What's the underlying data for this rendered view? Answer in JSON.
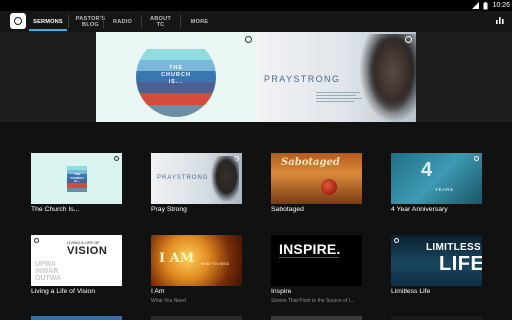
{
  "status_bar": {
    "time": "10:26"
  },
  "top_nav": {
    "tabs": [
      {
        "label": "SERMONS",
        "active": true
      },
      {
        "label": "PASTOR'S\nBLOG",
        "active": false
      },
      {
        "label": "RADIO",
        "active": false
      },
      {
        "label": "ABOUT\nTC",
        "active": false
      },
      {
        "label": "MORE",
        "active": false
      }
    ]
  },
  "hero": {
    "left": {
      "title_lines": [
        "THE",
        "CHURCH",
        "IS..."
      ]
    },
    "right": {
      "title": "PRAYSTRONG"
    }
  },
  "sermons": [
    {
      "title": "The Church Is...",
      "subtitle": ""
    },
    {
      "title": "Pray Strong",
      "subtitle": ""
    },
    {
      "title": "Sabotaged",
      "subtitle": ""
    },
    {
      "title": "4 Year Anniversary",
      "subtitle": ""
    },
    {
      "title": "Living a Life of Vision",
      "subtitle": ""
    },
    {
      "title": "I Am",
      "subtitle": "What You Need"
    },
    {
      "title": "Inspire",
      "subtitle": "Stories That Point to the Source of I..."
    },
    {
      "title": "Limitless Life",
      "subtitle": ""
    }
  ],
  "thumbs": {
    "church": [
      "THE",
      "CHURCH",
      "IS..."
    ],
    "praystrong": "PRAYSTRONG",
    "sabotaged": "Sabotaged",
    "anniversary": {
      "number": "4",
      "label": "YEARS"
    },
    "vision": {
      "small": "LIVING A LIFE OF",
      "big": "VISION",
      "side": [
        "UPWA",
        "INWAR",
        "OUTWA"
      ]
    },
    "iam": {
      "big": "I AM",
      "small": "WHAT YOU NEED"
    },
    "inspire": {
      "big": "INSPIRE."
    },
    "limitless": {
      "top": "LIMITLESS",
      "big": "LIFE"
    }
  },
  "colors": {
    "accent": "#2ab7f0",
    "nav_bg": "#161616",
    "page_bg": "#111111"
  }
}
